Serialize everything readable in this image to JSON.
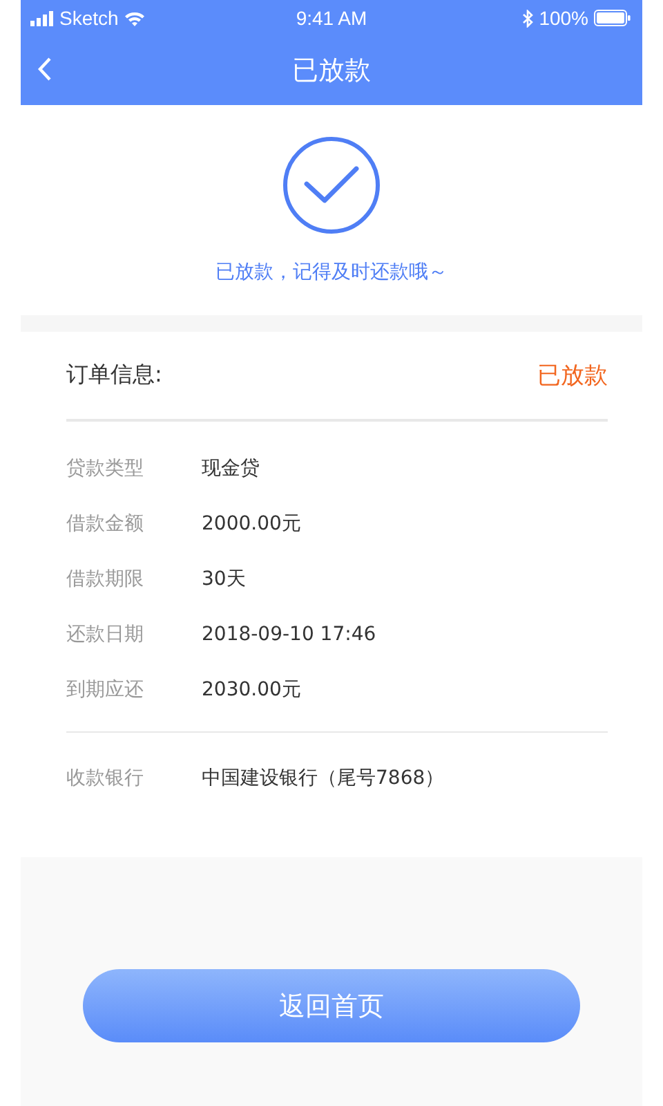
{
  "status_bar": {
    "carrier": "Sketch",
    "time": "9:41 AM",
    "battery": "100%"
  },
  "nav": {
    "title": "已放款"
  },
  "result": {
    "message": "已放款，记得及时还款哦～"
  },
  "order": {
    "heading": "订单信息:",
    "status": "已放款",
    "rows": [
      {
        "label": "贷款类型",
        "value": "现金贷"
      },
      {
        "label": "借款金额",
        "value": "2000.00元"
      },
      {
        "label": "借款期限",
        "value": "30天"
      },
      {
        "label": "还款日期",
        "value": "2018-09-10 17:46"
      },
      {
        "label": "到期应还",
        "value": "2030.00元"
      }
    ],
    "bank": {
      "label": "收款银行",
      "value": "中国建设银行（尾号7868）"
    }
  },
  "home_button": "返回首页"
}
